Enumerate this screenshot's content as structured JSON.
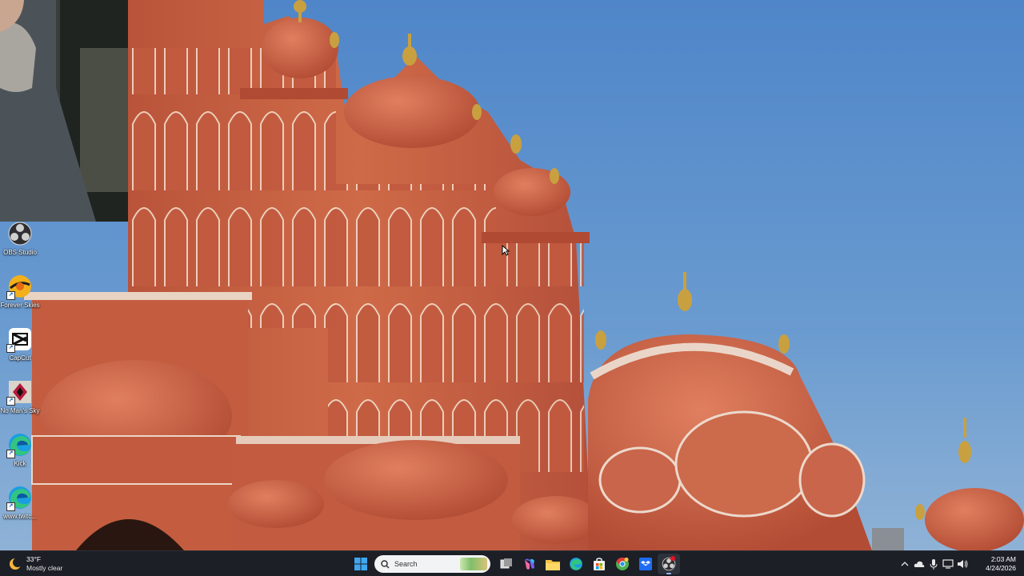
{
  "desktop": {
    "icons": [
      {
        "label": "OBS Studio",
        "icon": "obs-icon"
      },
      {
        "label": "Forever Skies",
        "icon": "forever-skies-icon"
      },
      {
        "label": "CapCut",
        "icon": "capcut-icon"
      },
      {
        "label": "No Man's Sky",
        "icon": "no-mans-sky-icon"
      },
      {
        "label": "Kick",
        "icon": "edge-icon"
      },
      {
        "label": "www.twitc...",
        "icon": "edge-icon"
      }
    ]
  },
  "taskbar": {
    "weather": {
      "temp": "33°F",
      "condition": "Mostly clear"
    },
    "search": {
      "placeholder": "Search"
    },
    "pinned": [
      "start-icon",
      "search-icon",
      "task-view-icon",
      "copilot-icon",
      "file-explorer-icon",
      "edge-icon",
      "store-icon",
      "chrome-icon",
      "dropbox-icon",
      "obs-icon"
    ],
    "clock": {
      "time": "2:03 AM",
      "date": "4/24/2026"
    }
  },
  "colors": {
    "taskbar_bg": "#1c1f26",
    "sky": "#5a90c8",
    "sandstone": "#c9603f"
  }
}
